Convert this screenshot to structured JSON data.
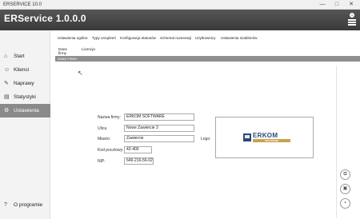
{
  "window": {
    "title": "ERSERVICE 10.0",
    "minimize": "—",
    "maximize": "□",
    "close": "✕"
  },
  "header": {
    "app_title": "ERService 1.0.0.0",
    "notification_count": "1"
  },
  "sidebar": {
    "items": [
      {
        "label": "Start",
        "icon": "home-icon"
      },
      {
        "label": "Klienci",
        "icon": "person-icon"
      },
      {
        "label": "Naprawy",
        "icon": "wrench-icon"
      },
      {
        "label": "Statystyki",
        "icon": "stats-icon"
      },
      {
        "label": "Ustawienia",
        "icon": "gear-icon"
      }
    ],
    "about": "O programie"
  },
  "tabs": [
    "Ustawienia ogólne",
    "Typy urządzeń",
    "Konfiguracja statusów",
    "Schemat numeracji",
    "Użytkownicy",
    "Ustawienia szablonów"
  ],
  "subtabs": [
    "Dane firmy",
    "Licencja"
  ],
  "section": {
    "title": "DANE FIRMY"
  },
  "form": {
    "name_label": "Nazwa firmy:",
    "name_value": "ERKOM SOFTWARE",
    "street_label": "Ulica",
    "street_value": "Nowe Zawiercie 3",
    "city_label": "Miasto:",
    "city_value": "Zawiercie",
    "postal_label": "Kod pocztowy:",
    "postal_value": "42-400",
    "nip_label": "NIP:",
    "nip_value": "649-216-56-02",
    "logo_label": "Logo:"
  },
  "logo": {
    "word": "ERKOM",
    "sub": "SOFTWARE"
  },
  "colors": {
    "header": "#3f3f3f",
    "sidebar_active": "#8a8a8a",
    "section_bar": "#8f8f8f",
    "logo_blue": "#2a4a78",
    "logo_gold": "#c9a24a"
  }
}
